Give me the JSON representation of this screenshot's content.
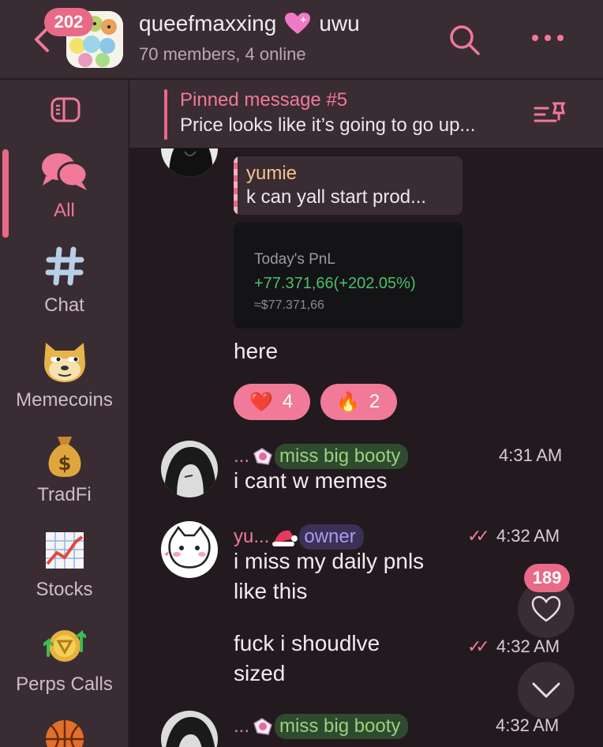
{
  "header": {
    "unread_badge": "202",
    "title": "queefmaxxing",
    "title_suffix": "uwu",
    "subtitle": "70 members, 4 online",
    "icons": {
      "back": "back-chevron-icon",
      "search": "search-icon",
      "more": "more-icon",
      "title_emoji": "pink-heart-icon"
    }
  },
  "sidebar": {
    "items": [
      {
        "label": "All",
        "icon": "chat-bubbles-icon",
        "active": true
      },
      {
        "label": "Chat",
        "icon": "hashtag-icon"
      },
      {
        "label": "Memecoins",
        "icon": "doge-icon"
      },
      {
        "label": "TradFi",
        "icon": "money-bag-icon"
      },
      {
        "label": "Stocks",
        "icon": "chart-icon"
      },
      {
        "label": "Perps Calls",
        "icon": "token-arrows-icon"
      }
    ]
  },
  "pinned": {
    "title": "Pinned message #5",
    "text": "Price looks like it’s going to go up..."
  },
  "messages": {
    "reply": {
      "name": "yumie",
      "text": "k can yall start prod..."
    },
    "pnl": {
      "title": "Today's PnL",
      "value": "+77.371,66(+202.05%)",
      "approx": "≈$77.371,66"
    },
    "here": "here",
    "reactions": [
      {
        "emoji": "❤️",
        "count": "4"
      },
      {
        "emoji": "🔥",
        "count": "2"
      }
    ],
    "m1": {
      "sender_prefix": "...",
      "tag": "miss big booty",
      "time": "4:31 AM",
      "text": "i cant w memes"
    },
    "m2": {
      "sender_prefix": "yu...",
      "tag": "owner",
      "time": "4:32 AM",
      "text1": "i miss my daily pnls",
      "text2": "like this"
    },
    "m3": {
      "time": "4:32 AM",
      "text1": "fuck i shoudlve",
      "text2": "sized"
    },
    "m4": {
      "sender_prefix": "...",
      "tag": "miss big booty",
      "time": "4:32 AM"
    }
  },
  "floating": {
    "reaction_count": "189"
  },
  "colors": {
    "accent": "#e86a86",
    "panel": "#3a2c33",
    "bg": "#221a1f",
    "green_tag": "#9ad27e",
    "purple_tag": "#a99bf0"
  }
}
